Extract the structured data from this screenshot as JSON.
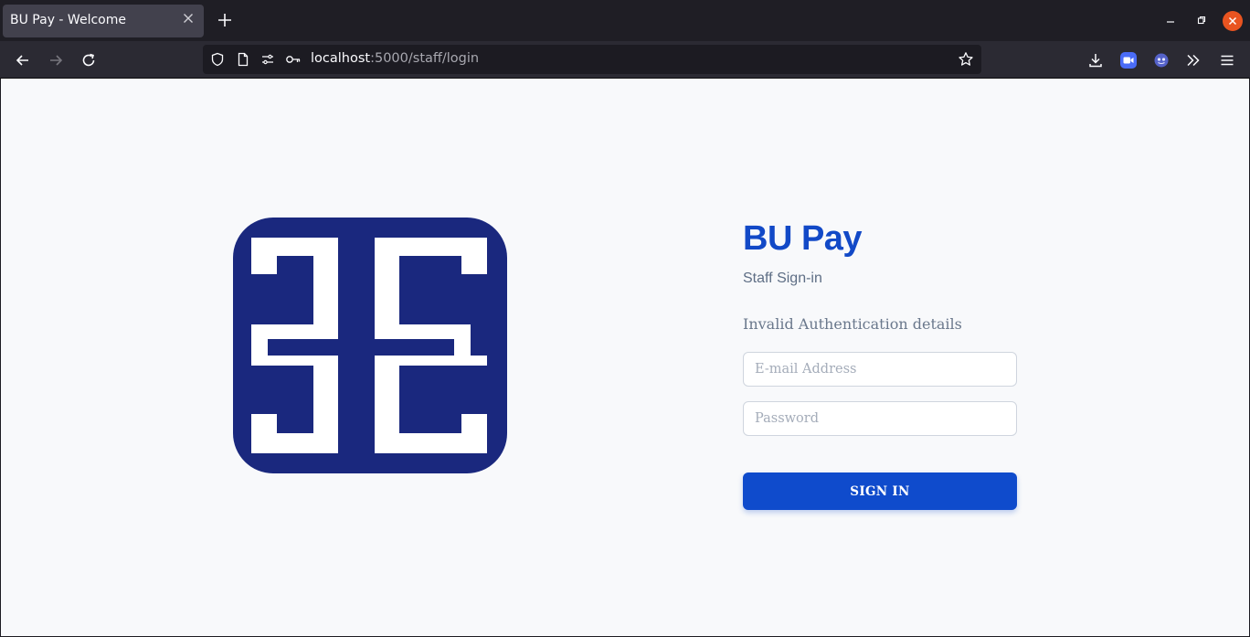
{
  "browser": {
    "tab_title": "BU Pay - Welcome",
    "url_host": "localhost",
    "url_path": ":5000/staff/login"
  },
  "page": {
    "brand": "BU Pay",
    "subtitle": "Staff Sign-in",
    "error_message": "Invalid Authentication details",
    "email_placeholder": "E-mail Address",
    "password_placeholder": "Password",
    "signin_label": "SIGN IN"
  },
  "colors": {
    "brand_blue": "#1249c7",
    "logo_navy": "#1a287e",
    "button_blue": "#0f4bcc"
  },
  "icons": {
    "tab_close": "close-icon",
    "new_tab": "plus-icon",
    "back": "arrow-left-icon",
    "forward": "arrow-right-icon",
    "reload": "reload-icon",
    "shield": "shield-icon",
    "page": "page-icon",
    "permissions": "permissions-icon",
    "key": "key-icon",
    "bookmark": "star-icon",
    "downloads": "download-icon",
    "extension_video": "video-extension-icon",
    "extension_other": "extension-icon",
    "overflow": "chevrons-right-icon",
    "menu": "hamburger-menu-icon"
  }
}
